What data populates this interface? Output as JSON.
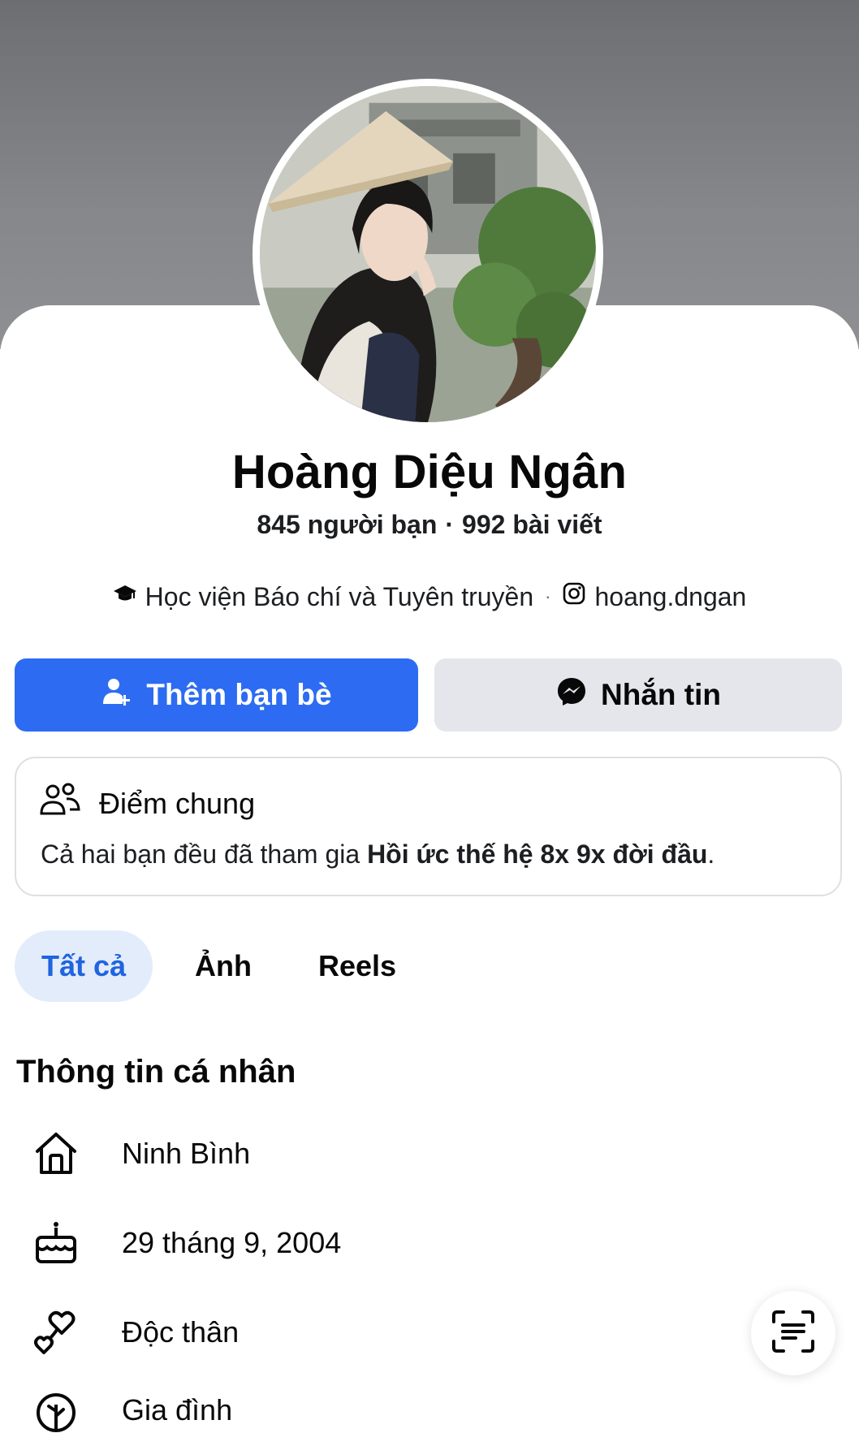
{
  "profile": {
    "name": "Hoàng Diệu Ngân",
    "friends": "845 người bạn",
    "dot": "·",
    "posts": "992 bài viết",
    "school": "Học viện Báo chí và Tuyên truyền",
    "detail_separator": "·",
    "instagram": "hoang.dngan"
  },
  "actions": {
    "add_friend_label": "Thêm bạn bè",
    "message_label": "Nhắn tin"
  },
  "mutual": {
    "title": "Điểm chung",
    "text_prefix": "Cả hai bạn đều đã tham gia ",
    "group_name": "Hồi ức thế hệ 8x 9x đời đầu",
    "text_suffix": "."
  },
  "tabs": [
    {
      "label": "Tất cả",
      "active": true
    },
    {
      "label": "Ảnh",
      "active": false
    },
    {
      "label": "Reels",
      "active": false
    }
  ],
  "personal_info": {
    "title": "Thông tin cá nhân",
    "items": [
      {
        "icon": "home-icon",
        "text": "Ninh Bình"
      },
      {
        "icon": "birthday-cake-icon",
        "text": "29 tháng 9, 2004"
      },
      {
        "icon": "relationship-hearts-icon",
        "text": "Độc thân"
      },
      {
        "icon": "family-icon",
        "text": "Gia đình"
      }
    ]
  },
  "colors": {
    "primary": "#2d6cf2",
    "secondary_button": "#e4e6eb",
    "active_tab_bg": "#e3ecfb",
    "active_tab_text": "#1f64e0"
  }
}
